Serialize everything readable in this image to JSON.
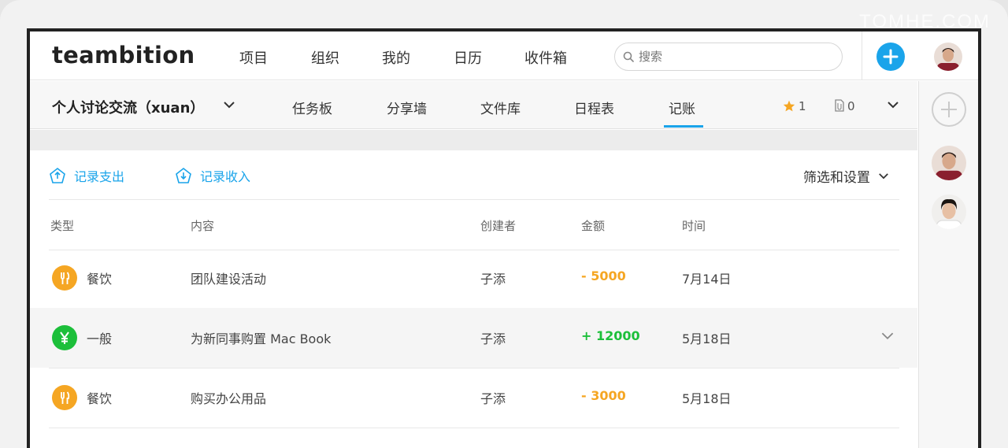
{
  "watermark": "TOMHE.COM",
  "app": {
    "logo": "teambition",
    "nav": [
      "项目",
      "组织",
      "我的",
      "日历",
      "收件箱"
    ],
    "search_placeholder": "搜索"
  },
  "project": {
    "title": "个人讨论交流（xuan）",
    "tabs": [
      "任务板",
      "分享墙",
      "文件库",
      "日程表",
      "记账"
    ],
    "active_tab": "记账",
    "star_count": "1",
    "attachment_count": "0"
  },
  "actions": {
    "record_expense": "记录支出",
    "record_income": "记录收入",
    "filter_settings": "筛选和设置"
  },
  "table": {
    "headers": [
      "类型",
      "内容",
      "创建者",
      "金额",
      "时间"
    ],
    "rows": [
      {
        "type": "餐饮",
        "content": "团队建设活动",
        "creator": "子添",
        "amount": "- 5000",
        "date": "7月14日",
        "kind": "expense"
      },
      {
        "type": "一般",
        "content": "为新同事购置 Mac Book",
        "creator": "子添",
        "amount": "+ 12000",
        "date": "5月18日",
        "kind": "income"
      },
      {
        "type": "餐饮",
        "content": "购买办公用品",
        "creator": "子添",
        "amount": "- 3000",
        "date": "5月18日",
        "kind": "expense"
      }
    ]
  },
  "colors": {
    "accent": "#1aa4ea",
    "expense": "#f5a623",
    "income": "#1cbf3a",
    "star": "#f5a623"
  }
}
